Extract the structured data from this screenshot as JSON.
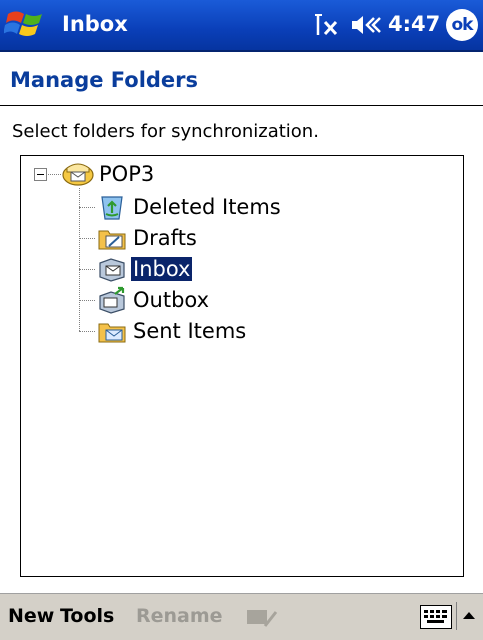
{
  "titlebar": {
    "app_title": "Inbox",
    "signal_icon": "no-signal-icon",
    "speaker_icon": "speaker-icon",
    "time": "4:47",
    "ok_label": "ok"
  },
  "page": {
    "title": "Manage Folders",
    "instruction": "Select folders for synchronization."
  },
  "tree": {
    "root": {
      "label": "POP3",
      "icon": "mailbox-icon",
      "expanded": true
    },
    "items": [
      {
        "label": "Deleted Items",
        "icon": "recycle-bin-icon",
        "selected": false
      },
      {
        "label": "Drafts",
        "icon": "drafts-folder-icon",
        "selected": false
      },
      {
        "label": "Inbox",
        "icon": "inbox-folder-icon",
        "selected": true
      },
      {
        "label": "Outbox",
        "icon": "outbox-folder-icon",
        "selected": false
      },
      {
        "label": "Sent Items",
        "icon": "sent-folder-icon",
        "selected": false
      }
    ]
  },
  "commandbar": {
    "new_label": "New",
    "tools_label": "Tools",
    "rename_label": "Rename",
    "stylus_icon": "stylus-icon",
    "keyboard_icon": "keyboard-icon",
    "sip_arrow_icon": "up-arrow-icon"
  },
  "colors": {
    "titlebar": "#0a3fb8",
    "page_title": "#0a3d9c",
    "selection": "#0a246a",
    "commandbar": "#d4d0c8"
  }
}
